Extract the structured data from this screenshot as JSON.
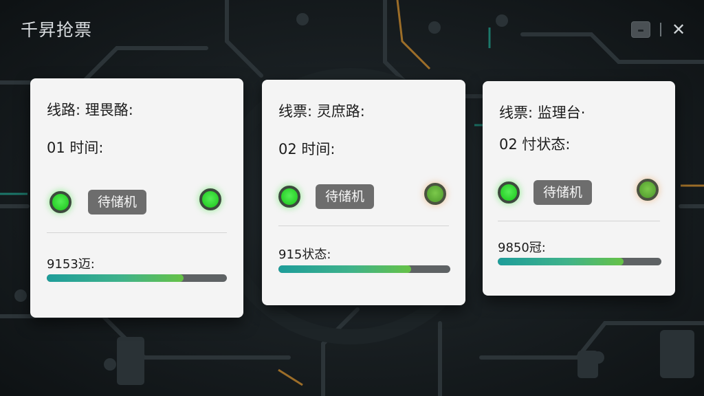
{
  "app": {
    "title": "千昇抢票"
  },
  "window": {
    "close_glyph": "✕"
  },
  "cards": [
    {
      "route": "线路: 理畏酪:",
      "info": "01 时间:",
      "status_badge": "待储机",
      "left_indicator": "green",
      "right_indicator": "green",
      "stat": "9153迈:",
      "progress": 0.76
    },
    {
      "route": "线票: 灵庶路:",
      "info": "02 时间:",
      "status_badge": "待储机",
      "left_indicator": "green",
      "right_indicator": "olive",
      "stat": "915状态:",
      "progress": 0.77
    },
    {
      "route": "线票: 监理台·",
      "info": "02 忖状态:",
      "status_badge": "待储机",
      "left_indicator": "green",
      "right_indicator": "olive",
      "stat": "9850冠:",
      "progress": 0.77
    }
  ],
  "colors": {
    "indicator_green": "#2bd02b",
    "indicator_olive": "#5aa534",
    "progress_start": "#1e9d9a",
    "progress_end": "#66c246",
    "background": "#141a1d"
  }
}
